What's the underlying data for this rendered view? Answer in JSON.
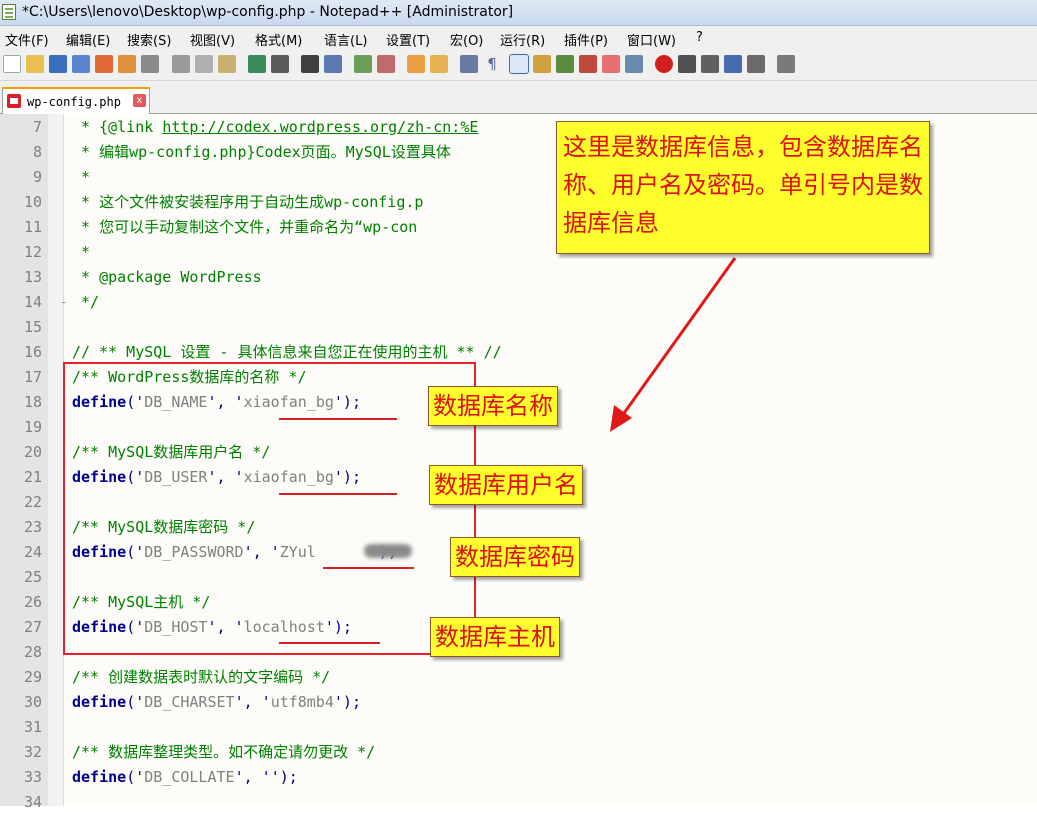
{
  "window": {
    "title": "*C:\\Users\\lenovo\\Desktop\\wp-config.php - Notepad++ [Administrator]"
  },
  "menu": [
    "文件(F)",
    "编辑(E)",
    "搜索(S)",
    "视图(V)",
    "格式(M)",
    "语言(L)",
    "设置(T)",
    "宏(O)",
    "运行(R)",
    "插件(P)",
    "窗口(W)",
    "?"
  ],
  "tab": {
    "label": "wp-config.php",
    "close": "x"
  },
  "line_numbers": [
    "7",
    "8",
    "9",
    "10",
    "11",
    "12",
    "13",
    "14",
    "15",
    "16",
    "17",
    "18",
    "19",
    "20",
    "21",
    "22",
    "23",
    "24",
    "25",
    "26",
    "27",
    "28",
    "29",
    "30",
    "31",
    "32",
    "33",
    "34"
  ],
  "code": {
    "l7_pre": " * {@link ",
    "l7_url": "http://codex.wordpress.org/zh-cn:%E",
    "l8": " * 编辑wp-config.php}Codex页面。MySQL设置具体",
    "l9": " *",
    "l10": " * 这个文件被安装程序用于自动生成wp-config.p",
    "l11": " * 您可以手动复制这个文件，并重命名为“wp-con",
    "l12": " *",
    "l13": " * @package WordPress",
    "l14": " */",
    "l16": "// ** MySQL 设置 - 具体信息来自您正在使用的主机 ** //",
    "l17": "/** WordPress数据库的名称 */",
    "l18_kw": "define",
    "l18_a": "('",
    "l18_key": "DB_NAME",
    "l18_b": "', '",
    "l18_val": "xiaofan_bg",
    "l18_c": "');",
    "l20": "/** MySQL数据库用户名 */",
    "l21_kw": "define",
    "l21_a": "('",
    "l21_key": "DB_USER",
    "l21_b": "', '",
    "l21_val": "xiaofan_bg",
    "l21_c": "');",
    "l23": "/** MySQL数据库密码 */",
    "l24_kw": "define",
    "l24_a": "('",
    "l24_key": "DB_PASSWORD",
    "l24_b": "', '",
    "l24_val": "ZYul",
    "l24_c": "');",
    "l26": "/** MySQL主机 */",
    "l27_kw": "define",
    "l27_a": "('",
    "l27_key": "DB_HOST",
    "l27_b": "', '",
    "l27_val": "localhost",
    "l27_c": "');",
    "l29": "/** 创建数据表时默认的文字编码 */",
    "l30_kw": "define",
    "l30_a": "('",
    "l30_key": "DB_CHARSET",
    "l30_b": "', '",
    "l30_val": "utf8mb4",
    "l30_c": "');",
    "l32": "/** 数据库整理类型。如不确定请勿更改 */",
    "l33_kw": "define",
    "l33_a": "('",
    "l33_key": "DB_COLLATE",
    "l33_b": "', '",
    "l33_c": "');"
  },
  "callouts": {
    "main": "这里是数据库信息，包含数据库名称、用户名及密码。单引号内是数据库信息",
    "db_name": "数据库名称",
    "db_user": "数据库用户名",
    "db_password": "数据库密码",
    "db_host": "数据库主机"
  },
  "colors": {
    "callout_bg": "#ffff2e",
    "callout_text": "#e01010",
    "highlight_box": "#e8202a",
    "comment": "#008000",
    "keyword": "#00008b"
  }
}
